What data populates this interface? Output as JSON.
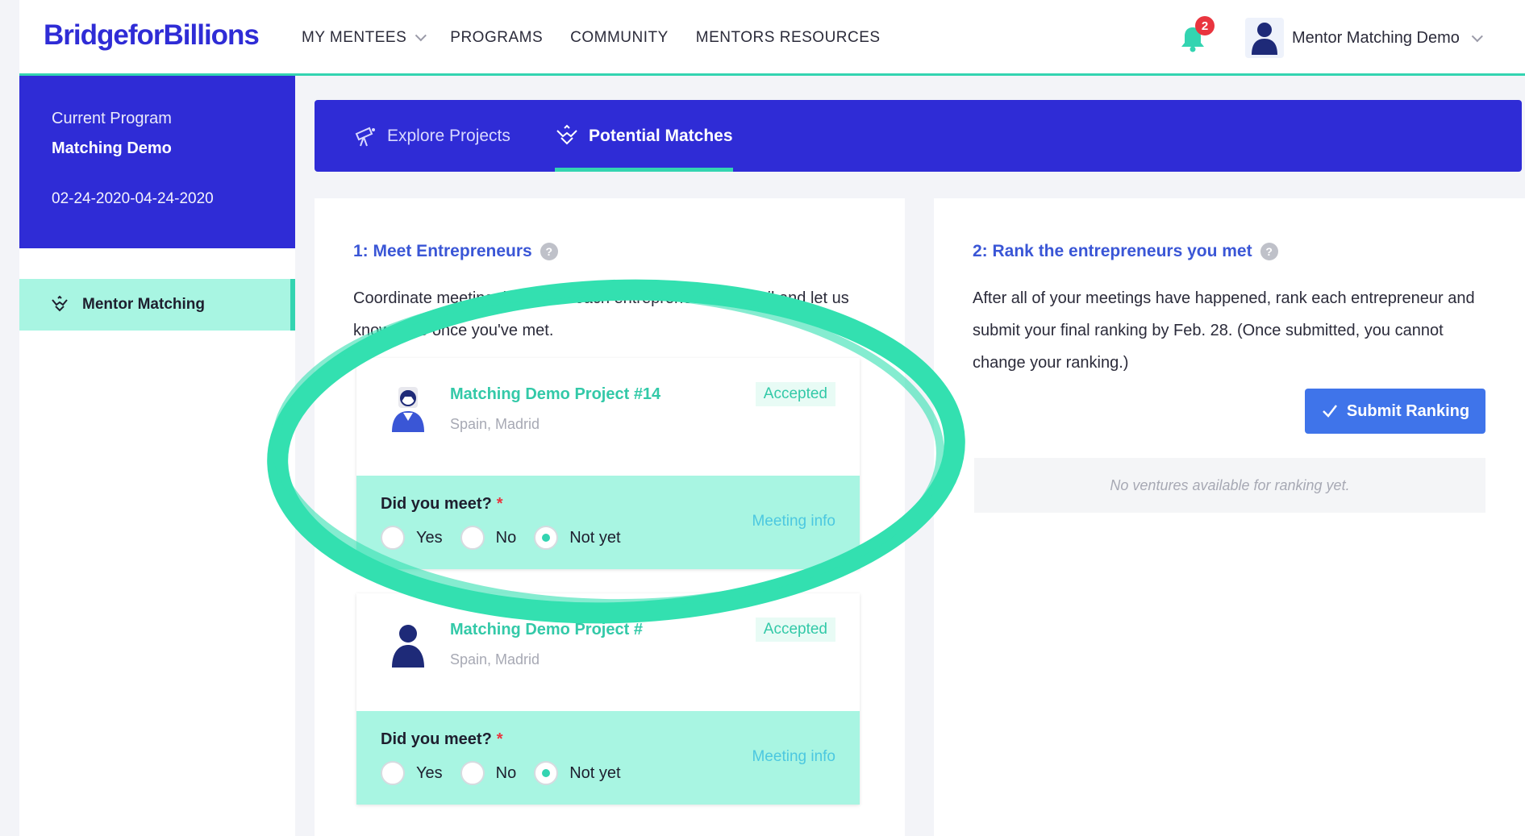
{
  "header": {
    "logo": "BridgeforBillions",
    "nav": [
      {
        "label": "MY MENTEES",
        "has_dropdown": true
      },
      {
        "label": "PROGRAMS"
      },
      {
        "label": "COMMUNITY"
      },
      {
        "label": "MENTORS RESOURCES"
      }
    ],
    "notifications_count": "2",
    "user_name": "Mentor Matching Demo"
  },
  "sidebar": {
    "program_label": "Current Program",
    "program_name": "Matching Demo",
    "program_dates": "02-24-2020-04-24-2020",
    "items": [
      {
        "label": "Mentor Matching",
        "active": true,
        "icon": "handshake-icon"
      }
    ]
  },
  "tabs": [
    {
      "label": "Explore Projects",
      "icon": "telescope-icon",
      "active": false
    },
    {
      "label": "Potential Matches",
      "icon": "handshake-icon",
      "active": true
    }
  ],
  "left_panel": {
    "title": "1: Meet Entrepreneurs",
    "description": "Coordinate meeting times with each entrepreneur via email and let us know here once you've met.",
    "projects": [
      {
        "title": "Matching Demo Project #14",
        "location": "Spain, Madrid",
        "status": "Accepted",
        "question": "Did you meet?",
        "required_mark": "*",
        "options": [
          "Yes",
          "No",
          "Not yet"
        ],
        "selected": "Not yet",
        "meeting_info": "Meeting info"
      },
      {
        "title": "Matching Demo Project #",
        "location": "Spain, Madrid",
        "status": "Accepted",
        "question": "Did you meet?",
        "required_mark": "*",
        "options": [
          "Yes",
          "No",
          "Not yet"
        ],
        "selected": "Not yet",
        "meeting_info": "Meeting info"
      }
    ]
  },
  "right_panel": {
    "title": "2: Rank the entrepreneurs you met",
    "description": "After all of your meetings have happened, rank each entrepreneur and submit your final ranking by Feb. 28. (Once submitted, you cannot change your ranking.)",
    "submit_label": "Submit Ranking",
    "empty_message": "No ventures available for ranking yet."
  },
  "colors": {
    "brand": "#2f2cd6",
    "accent": "#33d4b1",
    "light_accent": "#a8f5e2",
    "link": "#3a56d6",
    "button": "#3f74ea",
    "badge": "#e9353f"
  }
}
